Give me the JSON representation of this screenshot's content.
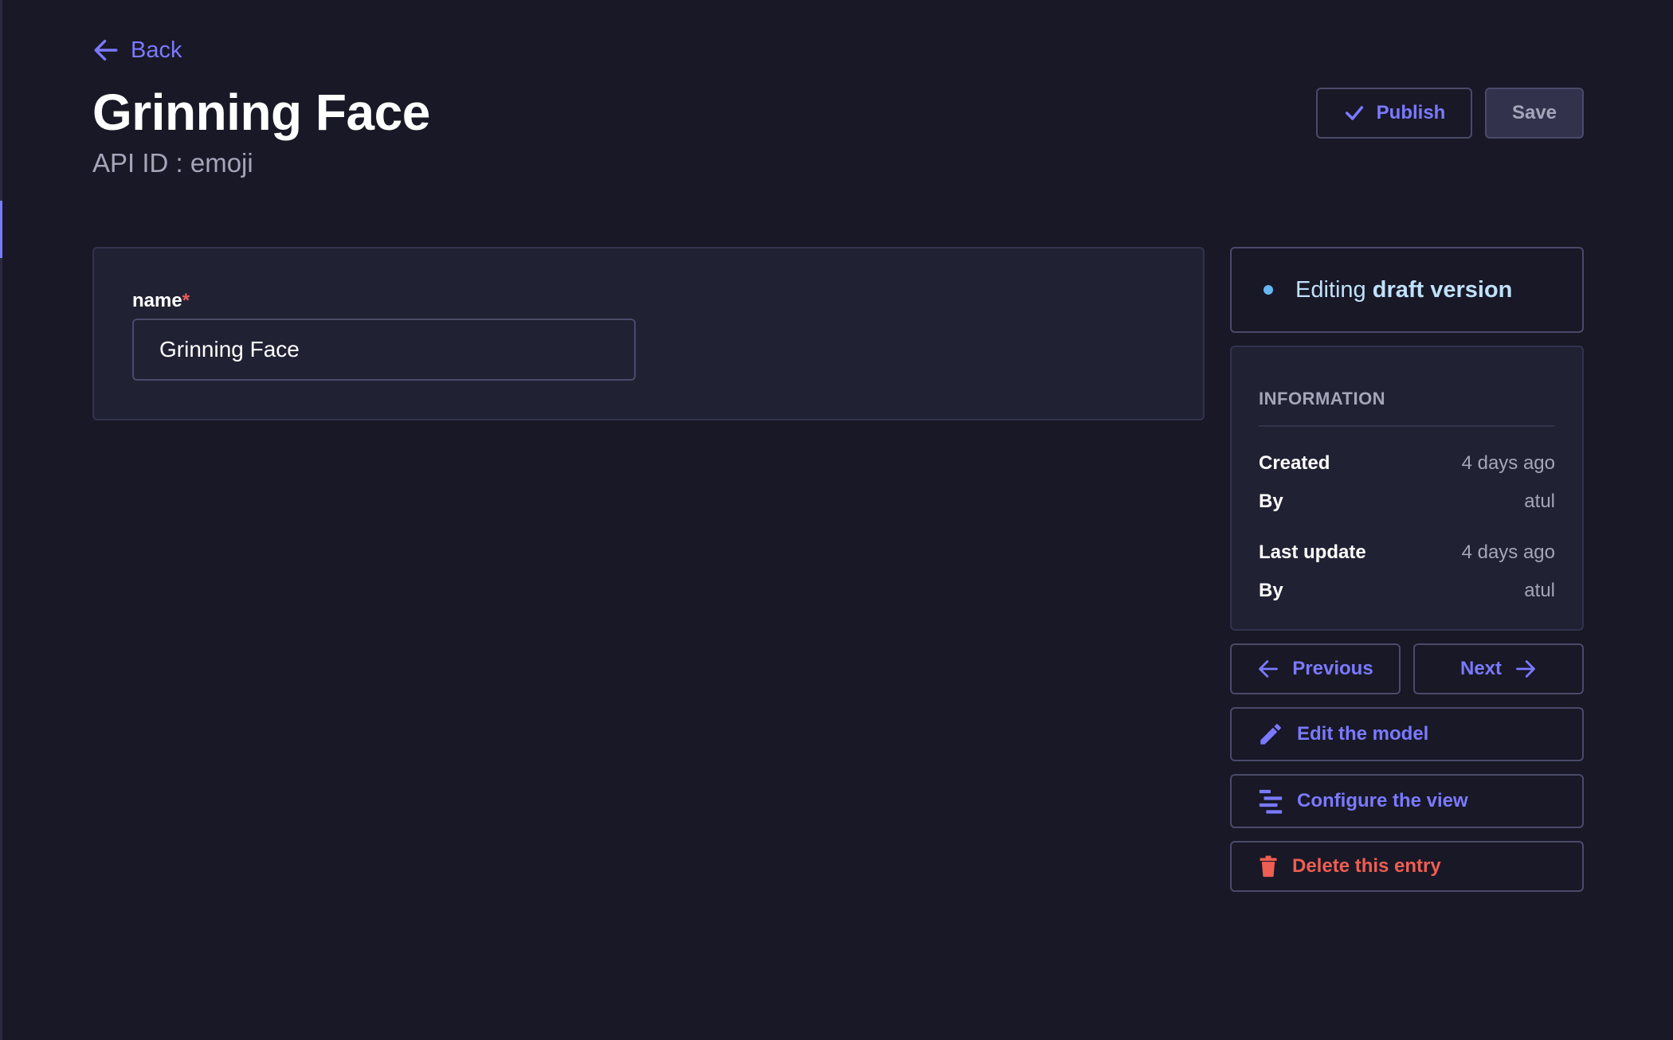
{
  "header": {
    "back_label": "Back",
    "title": "Grinning Face",
    "api_id": "API ID : emoji",
    "publish_label": "Publish",
    "save_label": "Save"
  },
  "form": {
    "field_label": "name",
    "required_mark": "*",
    "field_value": "Grinning Face"
  },
  "sidebar": {
    "status_prefix": "Editing",
    "status_emphasis": "draft version",
    "info_heading": "INFORMATION",
    "created_label": "Created",
    "created_value": "4 days ago",
    "created_by_label": "By",
    "created_by_value": "atul",
    "updated_label": "Last update",
    "updated_value": "4 days ago",
    "updated_by_label": "By",
    "updated_by_value": "atul"
  },
  "actions": {
    "previous_label": "Previous",
    "next_label": "Next",
    "edit_model_label": "Edit the model",
    "configure_view_label": "Configure the view",
    "delete_label": "Delete this entry"
  },
  "icons": {
    "back": "arrow-left-icon",
    "publish": "check-icon",
    "previous": "arrow-left-icon",
    "next": "arrow-right-icon",
    "edit": "pencil-icon",
    "configure": "layout-icon",
    "delete": "trash-icon"
  },
  "colors": {
    "background": "#181826",
    "card": "#212134",
    "accent": "#7b79ff",
    "danger": "#ee5e52",
    "status_dot": "#66b7f1"
  }
}
